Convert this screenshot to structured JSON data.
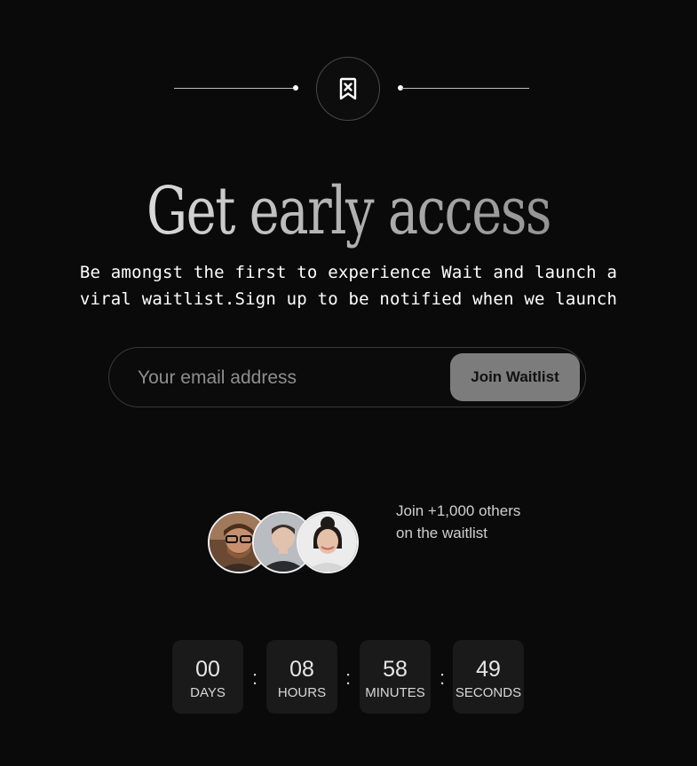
{
  "badge": {
    "icon": "bookmark-x-icon"
  },
  "headline": "Get early access",
  "subtitle": {
    "line1": "Be amongst the first to experience Wait and launch a",
    "line2": "viral waitlist.Sign up to be notified when we launch"
  },
  "form": {
    "email_placeholder": "Your email address",
    "email_value": "",
    "button_label": "Join Waitlist"
  },
  "social_proof": {
    "line1": "Join +1,000 others",
    "line2": "on the waitlist",
    "avatars": [
      "avatar-1",
      "avatar-2",
      "avatar-3"
    ]
  },
  "countdown": {
    "days": {
      "value": "00",
      "label": "DAYS"
    },
    "hours": {
      "value": "08",
      "label": "HOURS"
    },
    "minutes": {
      "value": "58",
      "label": "MINUTES"
    },
    "seconds": {
      "value": "49",
      "label": "SECONDS"
    },
    "separator": ":"
  },
  "colors": {
    "background": "#0a0a0a",
    "button": "#7c7c7c",
    "countdown_box": "#1a1a1a"
  }
}
